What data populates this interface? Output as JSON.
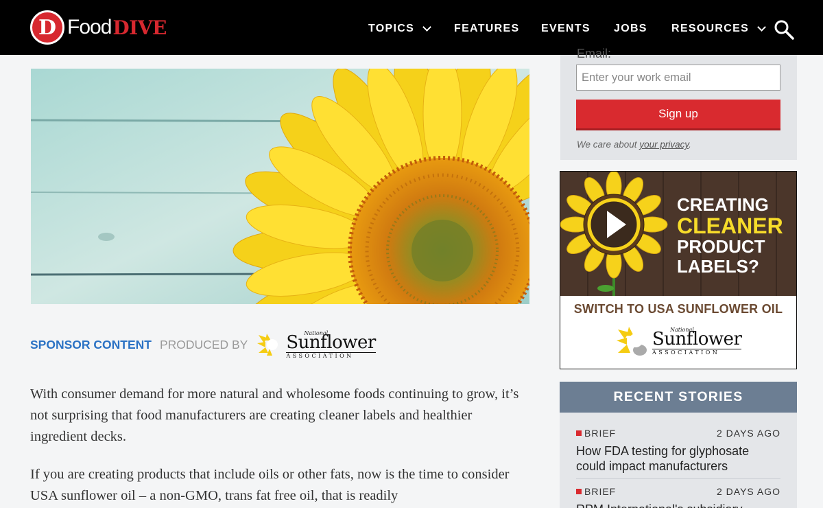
{
  "header": {
    "logo_food": "Food",
    "logo_dive": "DIVE",
    "logo_letter": "D",
    "nav": [
      {
        "label": "TOPICS",
        "has_dropdown": true
      },
      {
        "label": "FEATURES",
        "has_dropdown": false
      },
      {
        "label": "EVENTS",
        "has_dropdown": false
      },
      {
        "label": "JOBS",
        "has_dropdown": false
      },
      {
        "label": "RESOURCES",
        "has_dropdown": true
      }
    ],
    "search_icon": "search-icon"
  },
  "sponsor": {
    "label": "SPONSOR CONTENT",
    "produced_by": "PRODUCED BY",
    "logo": {
      "national": "National",
      "name": "Sunflower",
      "association": "ASSOCIATION"
    }
  },
  "article": {
    "paragraphs": [
      "With consumer demand for more natural and wholesome foods continuing to grow, it’s not surprising that food manufacturers are creating cleaner labels and healthier ingredient decks.",
      "If you are creating products that include oils or other fats, now is the time to consider USA sunflower oil – a non-GMO, trans fat free oil, that is readily"
    ]
  },
  "signup": {
    "email_label": "Email:",
    "email_placeholder": "Enter your work email",
    "email_value": "",
    "button": "Sign up",
    "privacy_prefix": "We care about",
    "privacy_link": "your privacy",
    "privacy_suffix": "."
  },
  "ad": {
    "line1": "CREATING",
    "line2": "CLEANER",
    "line3": "PRODUCT",
    "line4": "LABELS?",
    "switch": "SWITCH TO USA SUNFLOWER OIL",
    "logo": {
      "national": "National",
      "name": "Sunflower",
      "association": "ASSOCIATION"
    },
    "play_icon": "play-icon"
  },
  "recent": {
    "heading": "RECENT STORIES",
    "stories": [
      {
        "tag": "BRIEF",
        "age": "2 DAYS AGO",
        "title": "How FDA testing for glyphosate could impact manufacturers"
      },
      {
        "tag": "BRIEF",
        "age": "2 DAYS AGO",
        "title": "RPM International's subsidiary"
      }
    ]
  },
  "colors": {
    "brand_red": "#d7282f",
    "sponsor_blue": "#2b72c4",
    "recent_header": "#6c7e93",
    "ad_yellow": "#f7dc2a"
  }
}
